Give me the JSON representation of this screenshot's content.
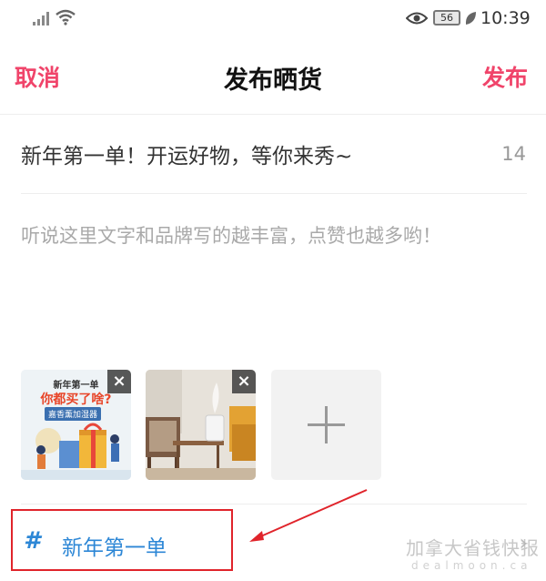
{
  "status_bar": {
    "battery": "56",
    "time": "10:39"
  },
  "navbar": {
    "cancel_label": "取消",
    "title": "发布晒货",
    "publish_label": "发布"
  },
  "editor": {
    "title_value": "新年第一单！开运好物，等你来秀~",
    "title_char_count": "14",
    "body_placeholder": "听说这里文字和品牌写的越丰富，点赞也越多哟！"
  },
  "images": [
    {
      "line1": "新年第一单",
      "line2": "你都买了啥?",
      "line3": "嘉香薰加湿器",
      "remove_icon": "×"
    },
    {
      "remove_icon": "×"
    }
  ],
  "topic": {
    "hash": "#",
    "label": "新年第一单",
    "chevron": "›"
  },
  "watermark": {
    "text": "加拿大省钱快报",
    "sub": "dealmoon.ca"
  },
  "colors": {
    "accent": "#f0446a",
    "topic": "#2d87d6",
    "annotation": "#e0242b"
  }
}
